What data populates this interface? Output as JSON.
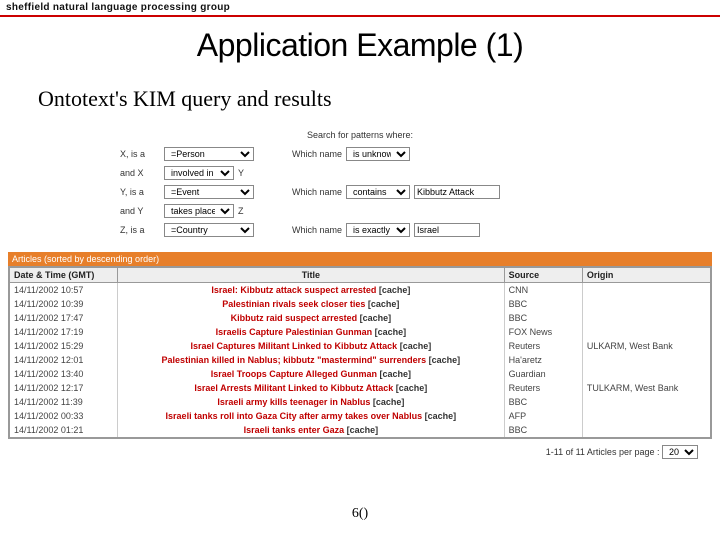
{
  "banner": "sheffield natural language processing group",
  "title": "Application Example (1)",
  "subtitle": "Ontotext's KIM query and results",
  "form": {
    "intro": "Search for patterns where:",
    "rows": [
      {
        "var": "X, is a",
        "typeSel": "=Person",
        "which": "Which name",
        "nameSel": "is unknown"
      },
      {
        "var": "and X",
        "relSel": "involved in",
        "target": "Y"
      },
      {
        "var": "Y, is a",
        "typeSel": "=Event",
        "which": "Which name",
        "nameSel": "contains",
        "valueInput": "Kibbutz Attack"
      },
      {
        "var": "and Y",
        "relSel": "takes place in",
        "target": "Z"
      },
      {
        "var": "Z, is a",
        "typeSel": "=Country",
        "which": "Which name",
        "nameSel": "is exactly",
        "valueInput": "Israel"
      }
    ]
  },
  "results": {
    "headerBar": "Articles (sorted by descending order)",
    "columns": {
      "date": "Date & Time (GMT)",
      "title": "Title",
      "source": "Source",
      "origin": "Origin"
    },
    "cacheLabel": "[cache]",
    "rows": [
      {
        "date": "14/11/2002 10:57",
        "title": "Israel: Kibbutz attack suspect arrested",
        "source": "CNN",
        "origin": ""
      },
      {
        "date": "14/11/2002 10:39",
        "title": "Palestinian rivals seek closer ties",
        "source": "BBC",
        "origin": ""
      },
      {
        "date": "14/11/2002 17:47",
        "title": "Kibbutz raid suspect arrested",
        "source": "BBC",
        "origin": ""
      },
      {
        "date": "14/11/2002 17:19",
        "title": "Israelis Capture Palestinian Gunman",
        "source": "FOX News",
        "origin": ""
      },
      {
        "date": "14/11/2002 15:29",
        "title": "Israel Captures Militant Linked to Kibbutz Attack",
        "source": "Reuters",
        "origin": "ULKARM, West Bank"
      },
      {
        "date": "14/11/2002 12:01",
        "title": "Palestinian killed in Nablus; kibbutz \"mastermind\" surrenders",
        "source": "Ha'aretz",
        "origin": ""
      },
      {
        "date": "14/11/2002 13:40",
        "title": "Israel Troops Capture Alleged Gunman",
        "source": "Guardian",
        "origin": ""
      },
      {
        "date": "14/11/2002 12:17",
        "title": "Israel Arrests Militant Linked to Kibbutz Attack",
        "source": "Reuters",
        "origin": "TULKARM, West Bank"
      },
      {
        "date": "14/11/2002 11:39",
        "title": "Israeli army kills teenager in Nablus",
        "source": "BBC",
        "origin": ""
      },
      {
        "date": "14/11/2002 00:33",
        "title": "Israeli tanks roll into Gaza City after army takes over Nablus",
        "source": "AFP",
        "origin": ""
      },
      {
        "date": "14/11/2002 01:21",
        "title": "Israeli tanks enter Gaza",
        "source": "BBC",
        "origin": ""
      }
    ],
    "pager": {
      "text": "1-11 of 11  Articles per page :",
      "value": "20"
    }
  },
  "footer": "6()"
}
